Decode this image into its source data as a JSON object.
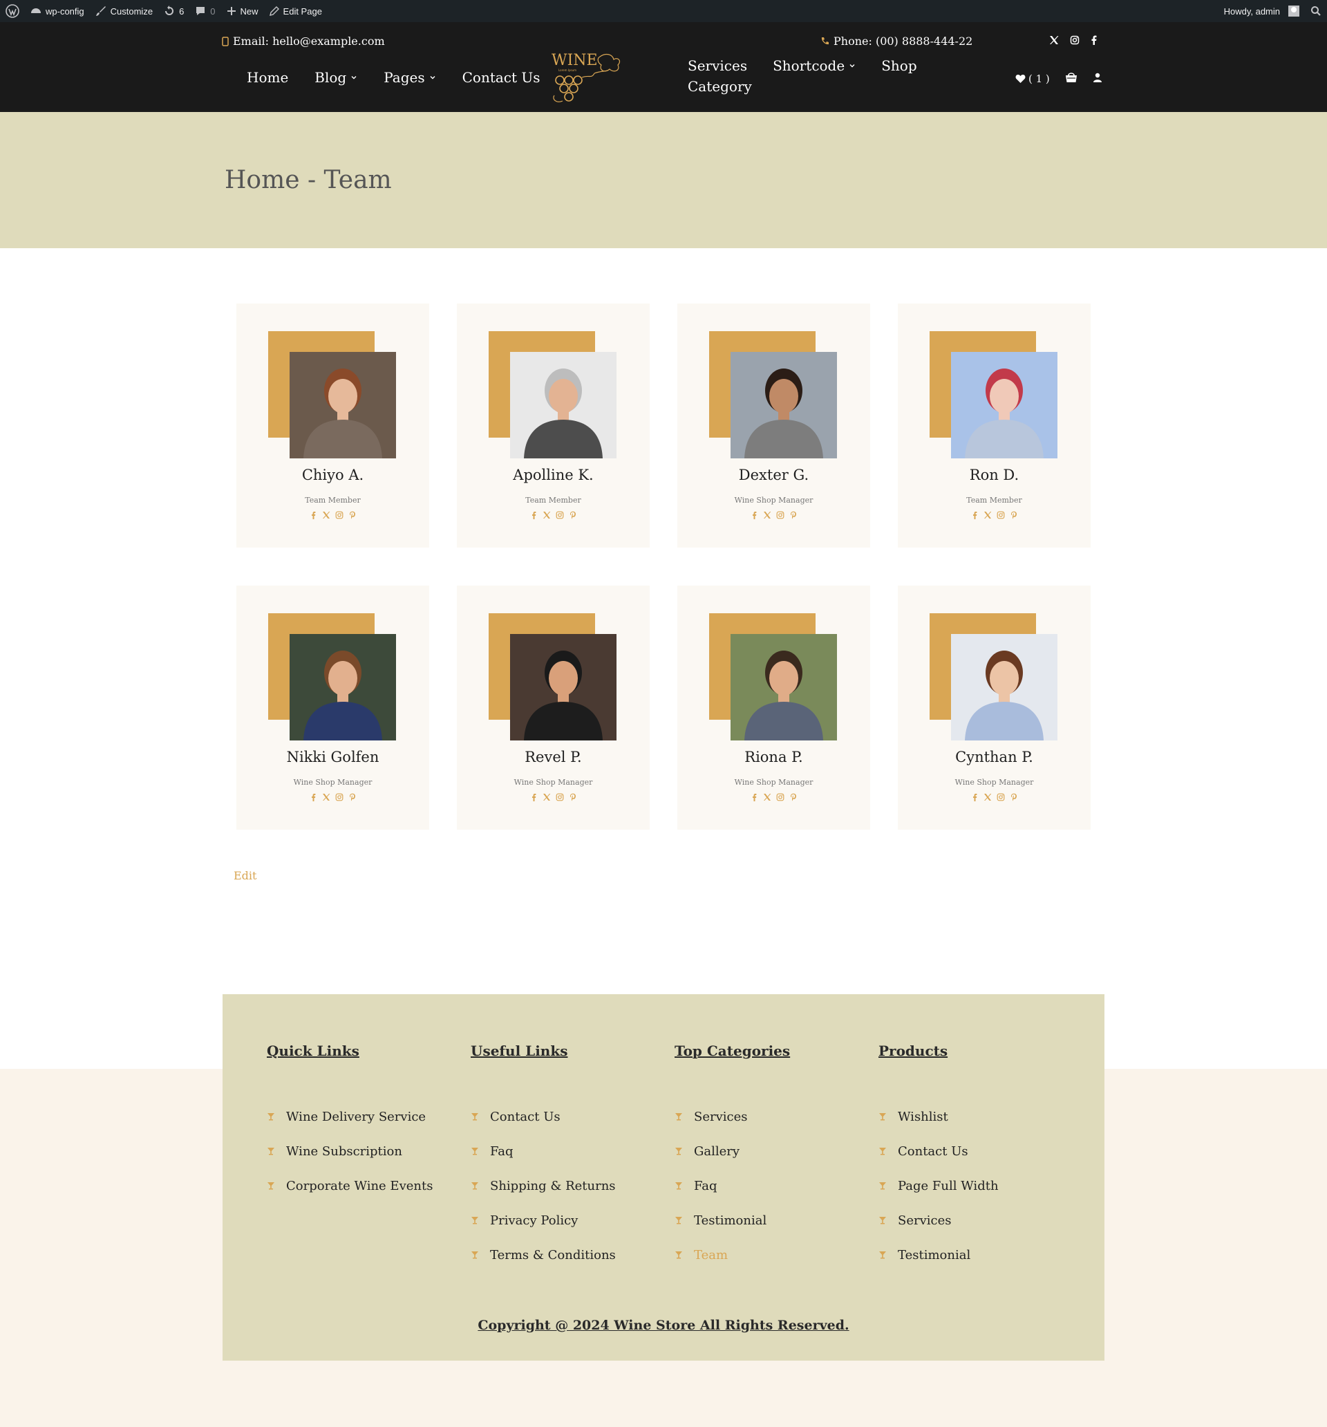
{
  "admin_bar": {
    "site_name": "wp-config",
    "customize": "Customize",
    "updates_count": "6",
    "comments_count": "0",
    "new_label": "New",
    "edit_page": "Edit Page",
    "howdy": "Howdy, admin"
  },
  "header": {
    "email": "Email: hello@example.com",
    "phone": "Phone: (00) 8888-444-22",
    "nav_left": [
      {
        "label": "Home",
        "has_dropdown": false
      },
      {
        "label": "Blog",
        "has_dropdown": true
      },
      {
        "label": "Pages",
        "has_dropdown": true
      },
      {
        "label": "Contact Us",
        "has_dropdown": false
      }
    ],
    "nav_right": [
      {
        "label": "Services",
        "has_dropdown": false
      },
      {
        "label": "Shortcode",
        "has_dropdown": true
      },
      {
        "label": "Shop",
        "has_dropdown": false
      },
      {
        "label": "Category",
        "has_dropdown": false
      }
    ],
    "logo": {
      "text": "WINE",
      "tagline": "Lorem Ipsum"
    },
    "wishlist_count": "( 1 )",
    "social": [
      "x-icon",
      "instagram-icon",
      "facebook-icon"
    ]
  },
  "page_title": "Home - Team",
  "team": [
    {
      "name": "Chiyo A.",
      "role": "Team Member"
    },
    {
      "name": "Apolline K.",
      "role": "Team Member"
    },
    {
      "name": "Dexter G.",
      "role": "Wine Shop Manager"
    },
    {
      "name": "Ron D.",
      "role": "Team Member"
    },
    {
      "name": "Nikki Golfen",
      "role": "Wine Shop Manager"
    },
    {
      "name": "Revel P.",
      "role": "Wine Shop Manager"
    },
    {
      "name": "Riona P.",
      "role": "Wine Shop Manager"
    },
    {
      "name": "Cynthan P.",
      "role": "Wine Shop Manager"
    }
  ],
  "edit_label": "Edit",
  "footer": {
    "columns": [
      {
        "title": "Quick Links",
        "items": [
          "Wine Delivery Service",
          "Wine Subscription",
          "Corporate Wine Events"
        ]
      },
      {
        "title": "Useful Links",
        "items": [
          "Contact Us",
          "Faq",
          "Shipping & Returns",
          "Privacy Policy",
          "Terms & Conditions"
        ]
      },
      {
        "title": "Top Categories",
        "items": [
          "Services",
          "Gallery",
          "Faq",
          "Testimonial",
          "Team"
        ],
        "active_index": 4
      },
      {
        "title": "Products",
        "items": [
          "Wishlist",
          "Contact Us",
          "Page Full Width",
          "Services",
          "Testimonial"
        ]
      }
    ],
    "copyright": "Copyright @ 2024 Wine Store All Rights Reserved."
  },
  "colors": {
    "accent": "#d9a654",
    "header_bg": "#1a1a1a",
    "band_bg": "#dfdbbb",
    "admin_bg": "#1d2327"
  }
}
